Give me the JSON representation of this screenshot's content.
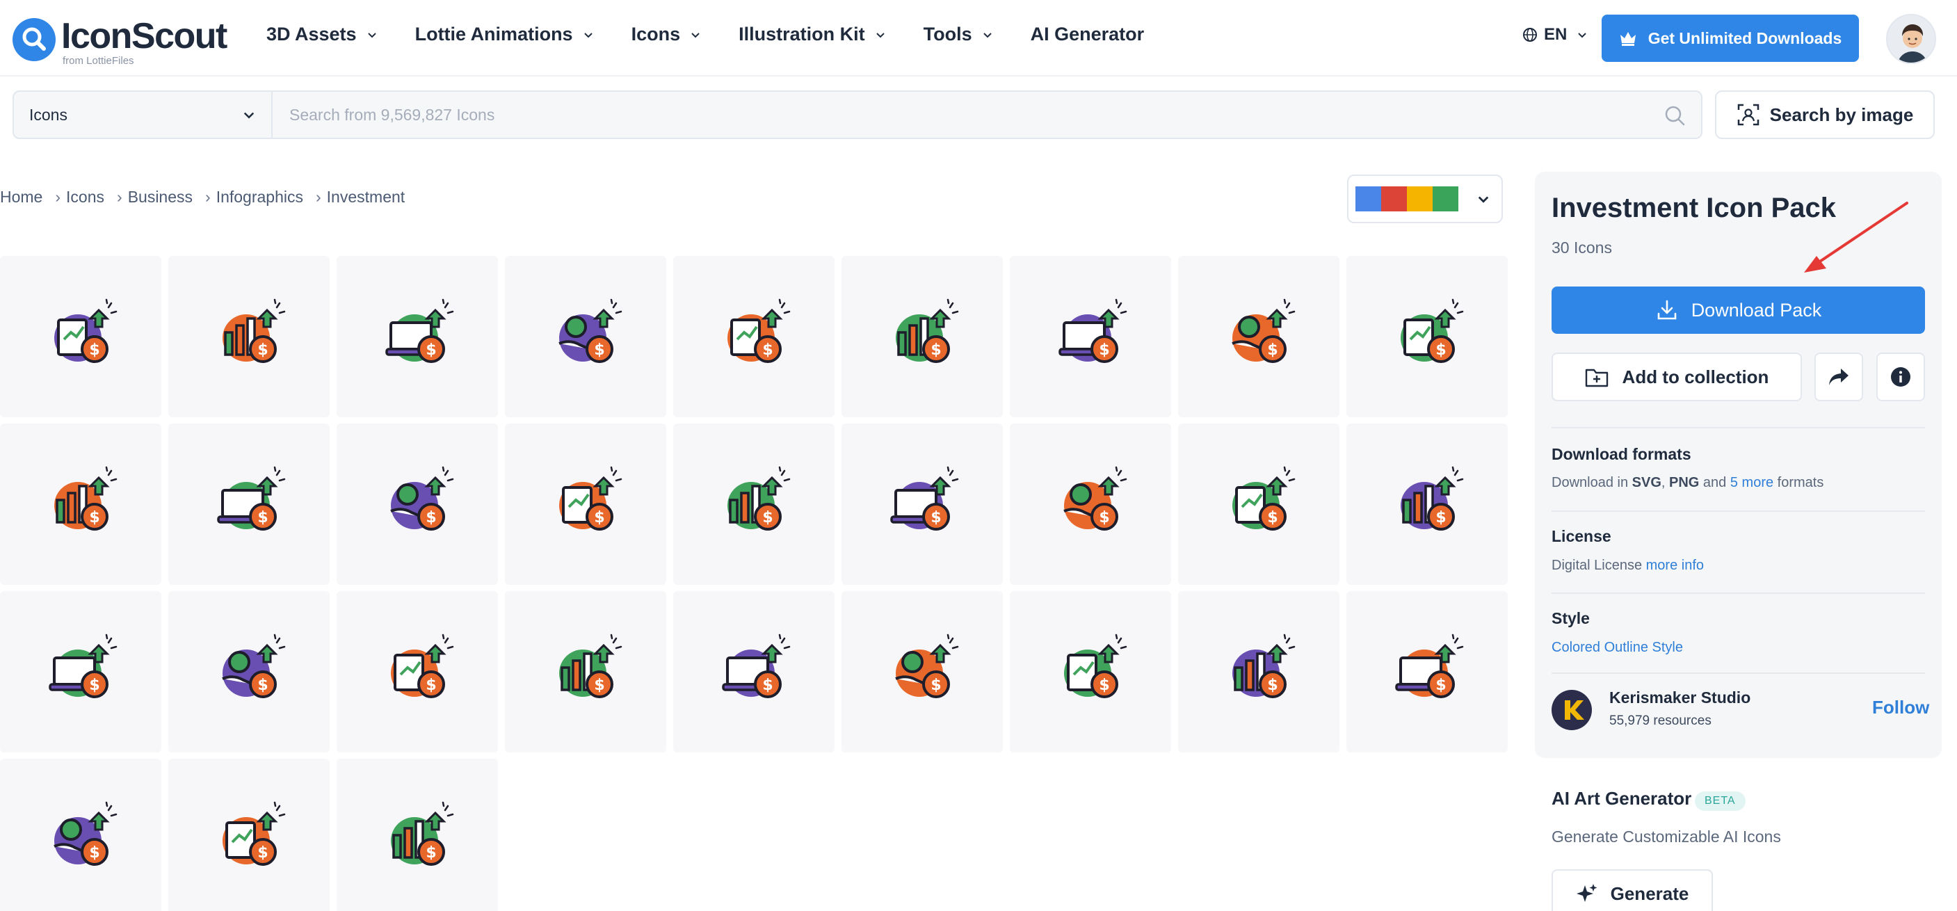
{
  "header": {
    "logo_name": "IconScout",
    "logo_sub": "from LottieFiles",
    "nav": [
      {
        "label": "3D Assets",
        "has_menu": true
      },
      {
        "label": "Lottie Animations",
        "has_menu": true
      },
      {
        "label": "Icons",
        "has_menu": true
      },
      {
        "label": "Illustration Kit",
        "has_menu": true
      },
      {
        "label": "Tools",
        "has_menu": true
      },
      {
        "label": "AI Generator",
        "has_menu": false
      }
    ],
    "language": "EN",
    "unlimited_label": "Get Unlimited Downloads"
  },
  "search": {
    "category": "Icons",
    "placeholder": "Search from 9,569,827 Icons",
    "search_by_image_label": "Search by image"
  },
  "breadcrumb": [
    "Home",
    "Icons",
    "Business",
    "Infographics",
    "Investment"
  ],
  "color_filter": {
    "swatches": [
      "#4a86e8",
      "#db4437",
      "#f4b400",
      "#3aa55a"
    ]
  },
  "colors": {
    "accent": "#2f86e6",
    "icon_orange": "#e8682b",
    "icon_purple": "#6a4fb3",
    "icon_green": "#3fa35b",
    "outline": "#1d1d2b"
  },
  "icons": [
    {
      "name": "document-growth-coins-icon"
    },
    {
      "name": "piggy-bank-icon"
    },
    {
      "name": "bull-market-icon"
    },
    {
      "name": "real-estate-investment-icon"
    },
    {
      "name": "hand-coin-cycle-icon"
    },
    {
      "name": "coin-arrows-icon"
    },
    {
      "name": "declining-chart-icon"
    },
    {
      "name": "coin-stack-growth-icon"
    },
    {
      "name": "global-investment-icon"
    },
    {
      "name": "gold-bars-hand-icon"
    },
    {
      "name": "plant-money-hand-icon"
    },
    {
      "name": "coin-directions-icon"
    },
    {
      "name": "growth-bar-chart-icon"
    },
    {
      "name": "target-coin-icon"
    },
    {
      "name": "hands-holding-coin-icon"
    },
    {
      "name": "investor-money-bag-icon"
    },
    {
      "name": "health-investment-icon"
    },
    {
      "name": "briefcase-investment-icon"
    },
    {
      "name": "coin-up-arrows-icon"
    },
    {
      "name": "house-investment-icon"
    },
    {
      "name": "laptop-stock-alert-icon"
    },
    {
      "name": "laptop-stock-clock-icon"
    },
    {
      "name": "interest-rate-icon"
    },
    {
      "name": "growth-bars-coin-icon"
    },
    {
      "name": "candlestick-coin-icon"
    },
    {
      "name": "candlestick-stock-icon"
    },
    {
      "name": "laptop-growth-chart-icon"
    },
    {
      "name": "stopwatch-coin-icon"
    },
    {
      "name": "laptop-candlestick-icon"
    },
    {
      "name": "report-analysis-eye-icon"
    }
  ],
  "panel": {
    "title": "Investment Icon Pack",
    "count": "30 Icons",
    "download_label": "Download Pack",
    "collection_label": "Add to collection",
    "formats_title": "Download formats",
    "formats_prefix": "Download in",
    "format_svg": "SVG",
    "format_sep": ",",
    "format_png": "PNG",
    "formats_and": "and",
    "formats_more": "5 more",
    "formats_suffix": "formats",
    "license_title": "License",
    "license_text": "Digital License",
    "license_link": "more info",
    "style_title": "Style",
    "style_value": "Colored Outline Style",
    "creator_name": "Kerismaker Studio",
    "creator_resources": "55,979 resources",
    "follow_label": "Follow"
  },
  "ai": {
    "title": "AI Art Generator",
    "badge": "BETA",
    "subtitle": "Generate Customizable AI Icons",
    "generate_label": "Generate"
  }
}
